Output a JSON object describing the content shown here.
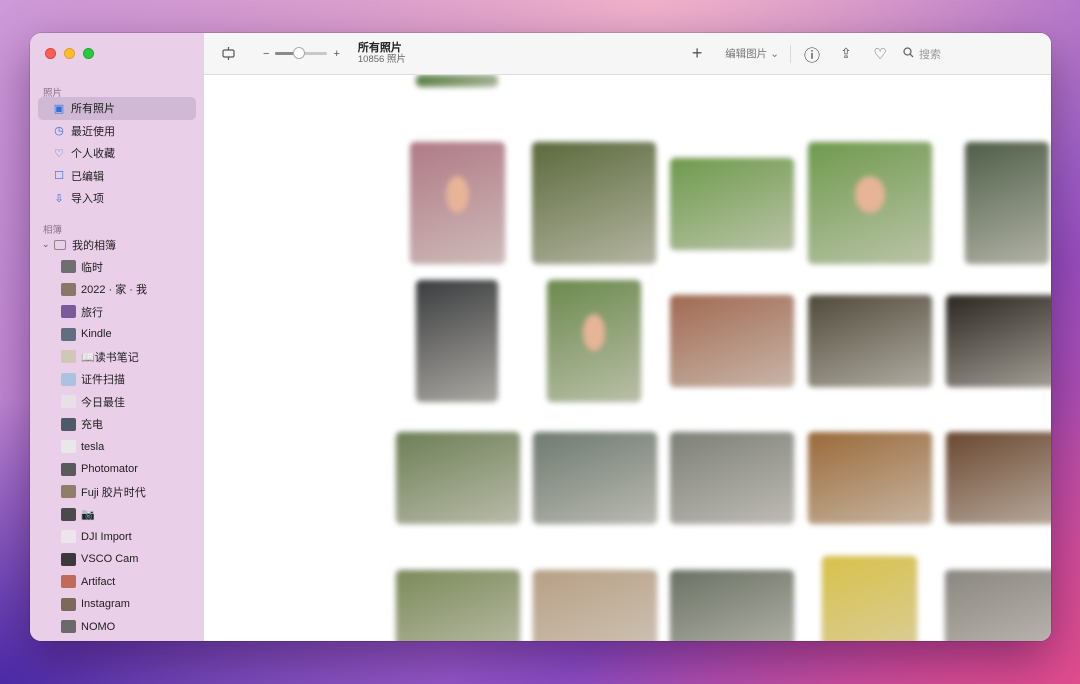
{
  "sidebar": {
    "section_photos": "照片",
    "items": [
      {
        "label": "所有照片",
        "icon": "▣",
        "name": "all-photos"
      },
      {
        "label": "最近使用",
        "icon": "◷",
        "name": "recents"
      },
      {
        "label": "个人收藏",
        "icon": "♡",
        "name": "favorites"
      },
      {
        "label": "已编辑",
        "icon": "☐",
        "name": "edited"
      },
      {
        "label": "导入项",
        "icon": "⇩",
        "name": "imports"
      }
    ],
    "section_albums": "相簿",
    "my_albums": "我的相簿",
    "albums": [
      {
        "label": "临时",
        "color": "#6f6f6f"
      },
      {
        "label": "2022 · 家 · 我",
        "color": "#8a7866"
      },
      {
        "label": "旅行",
        "color": "#7a5a9a"
      },
      {
        "label": "Kindle",
        "color": "#5f6f7f"
      },
      {
        "label": "📖读书笔记",
        "color": "#d0c7b5"
      },
      {
        "label": "证件扫描",
        "color": "#a9c3e0"
      },
      {
        "label": "今日最佳",
        "color": "#e8e0e8"
      },
      {
        "label": "充电",
        "color": "#4c5a6a"
      },
      {
        "label": "tesla",
        "color": "#e8e8e8"
      },
      {
        "label": "Photomator",
        "color": "#5a5a5a"
      },
      {
        "label": "Fuji 胶片时代",
        "color": "#8f7f6a"
      },
      {
        "label": "📷",
        "color": "#4a4a4a"
      },
      {
        "label": "DJI Import",
        "color": "#ece6ec"
      },
      {
        "label": "VSCO Cam",
        "color": "#3a3a3a"
      },
      {
        "label": "Artifact",
        "color": "#c06a5a"
      },
      {
        "label": "Instagram",
        "color": "#7a6a5a"
      },
      {
        "label": "NOMO",
        "color": "#6a6a6a"
      }
    ]
  },
  "toolbar": {
    "zoom_out": "−",
    "zoom_in": "+",
    "zoom_level": 0.45,
    "title": "所有照片",
    "subtitle": "10856 照片",
    "add": "+",
    "edit_label": "编辑图片",
    "info_icon": "ⓘ",
    "share_icon": "⇪",
    "favorite_icon": "♡",
    "search_placeholder": "搜索"
  },
  "photos": [
    {
      "color": "#4f7a3a"
    },
    {
      "color": "#b78a8a"
    },
    {
      "color": "#b07a86"
    },
    {
      "color": "#5b6a3c"
    },
    {
      "color": "#6e9a4c"
    },
    {
      "color": "#6f9a4e"
    },
    {
      "color": "#4f5e48"
    },
    {
      "color": "#4b4f50"
    },
    {
      "color": "#3a3c3e"
    },
    {
      "color": "#6b8a4e"
    },
    {
      "color": "#a06a52"
    },
    {
      "color": "#4f4a3a"
    },
    {
      "color": "#2c2620"
    },
    {
      "color": "#5a7d9a"
    },
    {
      "color": "#6d7f56"
    },
    {
      "color": "#6e7a70"
    },
    {
      "color": "#7d8078"
    },
    {
      "color": "#9a6a3a"
    },
    {
      "color": "#6a4830"
    },
    {
      "color": "#8c6e6e"
    },
    {
      "color": "#7b8a5a"
    },
    {
      "color": "#b7a085"
    },
    {
      "color": "#6a7264"
    },
    {
      "color": "#d8c24a"
    },
    {
      "color": "#8a8680"
    }
  ]
}
